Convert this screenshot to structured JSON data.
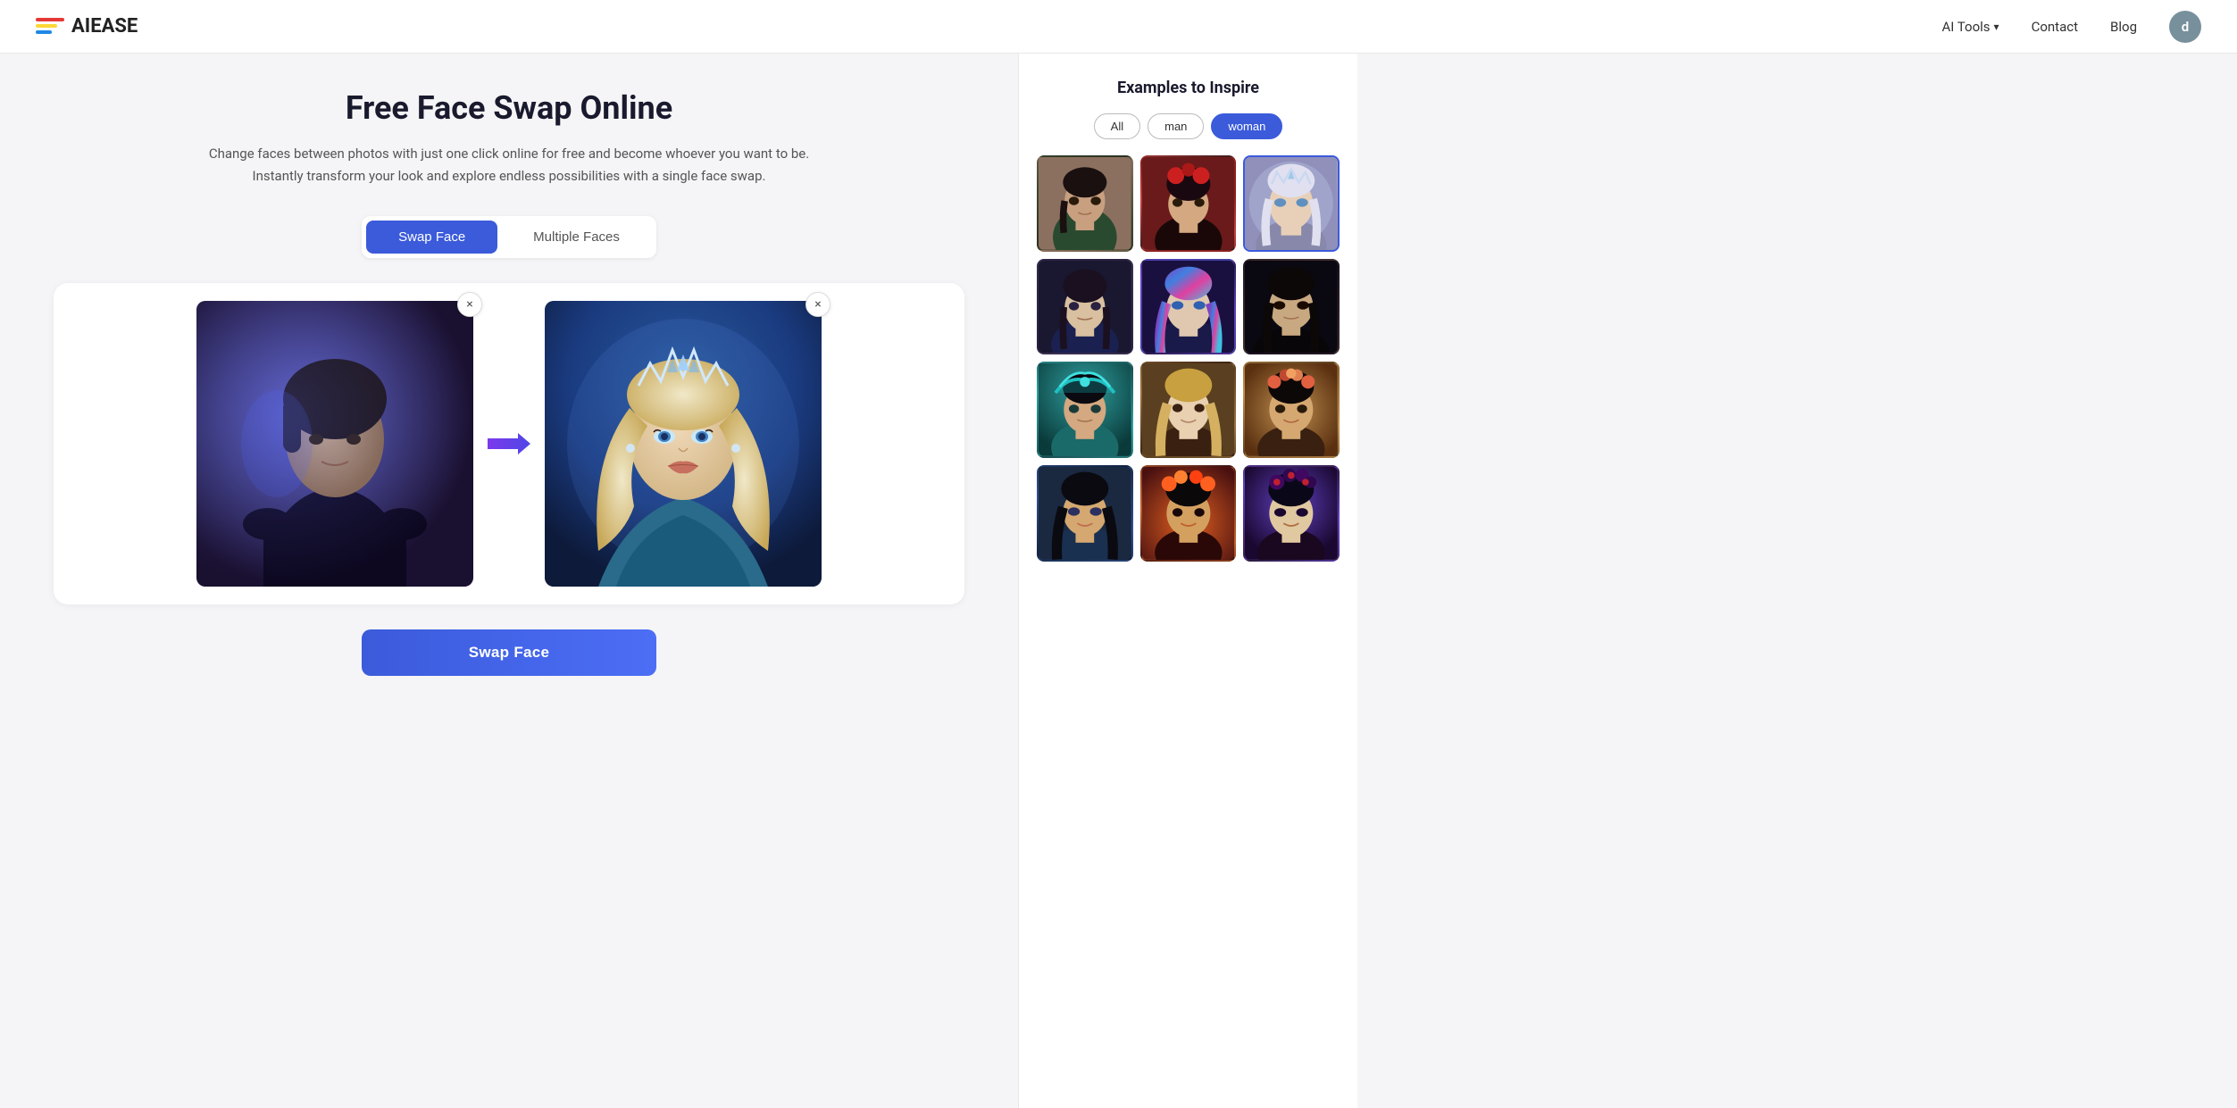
{
  "navbar": {
    "brand": "AIEASE",
    "nav_items": [
      {
        "label": "AI Tools",
        "has_dropdown": true
      },
      {
        "label": "Contact",
        "has_dropdown": false
      },
      {
        "label": "Blog",
        "has_dropdown": false
      }
    ],
    "avatar_initial": "d"
  },
  "main": {
    "title": "Free Face Swap Online",
    "subtitle": "Change faces between photos with just one click online for free and become whoever you want to be. Instantly transform your look and explore endless possibilities with a single face swap.",
    "tabs": [
      {
        "label": "Swap Face",
        "active": true
      },
      {
        "label": "Multiple Faces",
        "active": false
      }
    ],
    "source_close_label": "×",
    "target_close_label": "×",
    "swap_button": "Swap Face",
    "swap_button_bottom": "Swap Face"
  },
  "sidebar": {
    "title": "Examples to Inspire",
    "filters": [
      {
        "label": "All",
        "state": "all"
      },
      {
        "label": "man",
        "state": "man"
      },
      {
        "label": "woman",
        "state": "woman",
        "active": true
      }
    ],
    "images": [
      {
        "id": 1,
        "style": "portrait-1",
        "skin": "skin-tan",
        "hair": "hair-dark",
        "body": "body-green",
        "selected": false,
        "description": "woman in green jacket vintage style"
      },
      {
        "id": 2,
        "style": "portrait-2",
        "skin": "skin-fair",
        "hair": "hair-dark",
        "body": "body-dark",
        "selected": false,
        "description": "woman with red floral headpiece"
      },
      {
        "id": 3,
        "style": "portrait-3",
        "skin": "skin-light",
        "hair": "hair-white",
        "body": "body-black",
        "selected": true,
        "description": "fantasy woman with silver crown"
      },
      {
        "id": 4,
        "style": "portrait-4",
        "skin": "skin-fair",
        "hair": "hair-dark",
        "body": "body-blue",
        "selected": false,
        "description": "young woman dark background"
      },
      {
        "id": 5,
        "style": "portrait-5",
        "skin": "skin-fair",
        "hair": "hair-brown",
        "body": "body-blue",
        "selected": false,
        "description": "woman with colorful galaxy hair"
      },
      {
        "id": 6,
        "style": "portrait-6",
        "skin": "skin-medium",
        "hair": "hair-dark",
        "body": "body-black",
        "selected": false,
        "description": "woman bare shoulder dark background"
      },
      {
        "id": 7,
        "style": "portrait-7",
        "skin": "skin-medium",
        "hair": "hair-dark",
        "body": "body-teal",
        "selected": false,
        "description": "woman with teal headdress"
      },
      {
        "id": 8,
        "style": "portrait-8",
        "skin": "skin-light",
        "hair": "hair-blonde",
        "body": "body-brown",
        "selected": false,
        "description": "woman with long blonde hair"
      },
      {
        "id": 9,
        "style": "portrait-9",
        "skin": "skin-tan",
        "hair": "hair-dark",
        "body": "body-gold",
        "selected": false,
        "description": "woman with floral crown gold tones"
      },
      {
        "id": 10,
        "style": "portrait-10",
        "skin": "skin-tan",
        "hair": "hair-dark",
        "body": "body-blue",
        "selected": false,
        "description": "woman with dark hair glamour"
      },
      {
        "id": 11,
        "style": "portrait-11",
        "skin": "skin-tan",
        "hair": "hair-dark",
        "body": "body-dark",
        "selected": false,
        "description": "woman orange sunset floral crown"
      },
      {
        "id": 12,
        "style": "portrait-12",
        "skin": "skin-fair",
        "hair": "hair-dark",
        "body": "body-dark",
        "selected": false,
        "description": "woman dark fantasy floral headpiece"
      }
    ]
  }
}
